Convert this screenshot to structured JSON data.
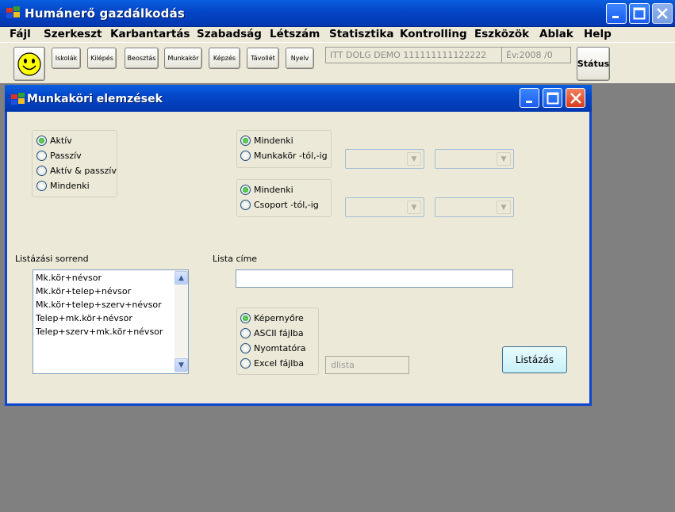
{
  "app": {
    "title": "Humánerő gazdálkodás"
  },
  "menu": [
    "Fájl",
    "Szerkeszt",
    "Karbantartás",
    "Szabadság",
    "Létszám",
    "Statisztika",
    "Kontrolling",
    "Eszközök",
    "Ablak",
    "Help"
  ],
  "toolbar": {
    "buttons": [
      "Iskolák",
      "Kilépés",
      "Beosztás",
      "Munkakör",
      "Képzés",
      "Távollét",
      "Nyelv"
    ],
    "status_text": "ITT DOLG DEMO 111111111122222",
    "year_text": "Év:2008  /0",
    "status_button": "Státus"
  },
  "window": {
    "title": "Munkaköri elemzések",
    "activity": [
      "Aktív",
      "Passzív",
      "Aktív & passzív",
      "Mindenki"
    ],
    "job_filter": [
      "Mindenki",
      "Munkakör -tól,-ig"
    ],
    "group_filter": [
      "Mindenki",
      "Csoport -tól,-ig"
    ],
    "sort_label": "Listázási sorrend",
    "sort_items": [
      "Mk.kör+névsor",
      "Mk.kör+telep+névsor",
      "Mk.kör+telep+szerv+névsor",
      "Telep+mk.kör+névsor",
      "Telep+szerv+mk.kör+névsor"
    ],
    "list_title_label": "Lista címe",
    "list_title_value": "",
    "output": [
      "Képernyőre",
      "ASCII fájlba",
      "Nyomtatóra",
      "Excel fájlba"
    ],
    "file_name": "dlista",
    "list_button": "Listázás"
  },
  "colors": {
    "titlebar": "#0447c8",
    "face": "#ece9d8",
    "desktop": "#808080"
  }
}
